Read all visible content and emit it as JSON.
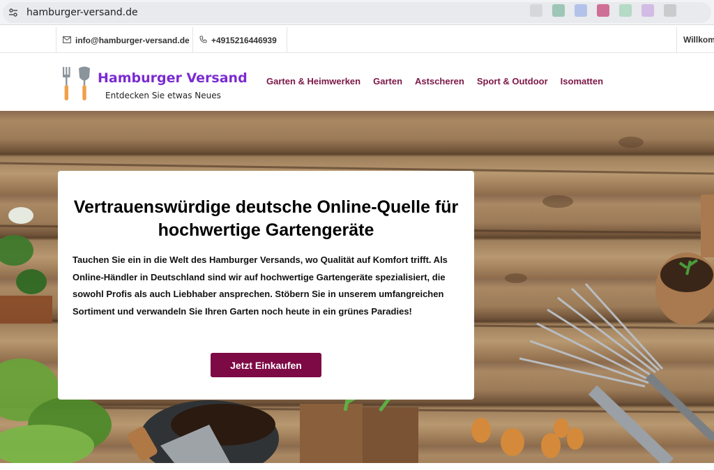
{
  "browser": {
    "url": "hamburger-versand.de",
    "site_info_icon": "tune-icon",
    "extension_colors": [
      "#cfcfcf",
      "#7fb7a0",
      "#9db1e6",
      "#c43a6f",
      "#9fd3b3",
      "#c9a7e0",
      "#bdbdbd"
    ]
  },
  "topbar": {
    "email_icon": "envelope-icon",
    "email": "info@hamburger-versand.de",
    "phone_icon": "phone-icon",
    "phone": "+4915216446939",
    "welcome": "Willkom"
  },
  "header": {
    "brand_name": "Hamburger Versand",
    "tagline": "Entdecken Sie etwas Neues",
    "logo_icon": "garden-tools-icon",
    "brand_color": "#7b2bd1",
    "nav_color": "#7b1747",
    "nav": [
      {
        "label": "Garten & Heimwerken"
      },
      {
        "label": "Garten"
      },
      {
        "label": "Astscheren"
      },
      {
        "label": "Sport & Outdoor"
      },
      {
        "label": "Isomatten"
      }
    ]
  },
  "hero": {
    "title": "Vertrauenswürdige deutsche Online-Quelle für hochwertige Gartengeräte",
    "text": "Tauchen Sie ein in die Welt des Hamburger Versands, wo Qualität auf Komfort trifft. Als Online-Händler in Deutschland sind wir auf hochwertige Gartengeräte spezialisiert, die sowohl Profis als auch Liebhaber ansprechen. Stöbern Sie in unserem umfangreichen Sortiment und verwandeln Sie Ihren Garten noch heute in ein grünes Paradies!",
    "cta_label": "Jetzt Einkaufen",
    "cta_color": "#7d0a45",
    "background_image": "garden-tools-on-wooden-table"
  }
}
